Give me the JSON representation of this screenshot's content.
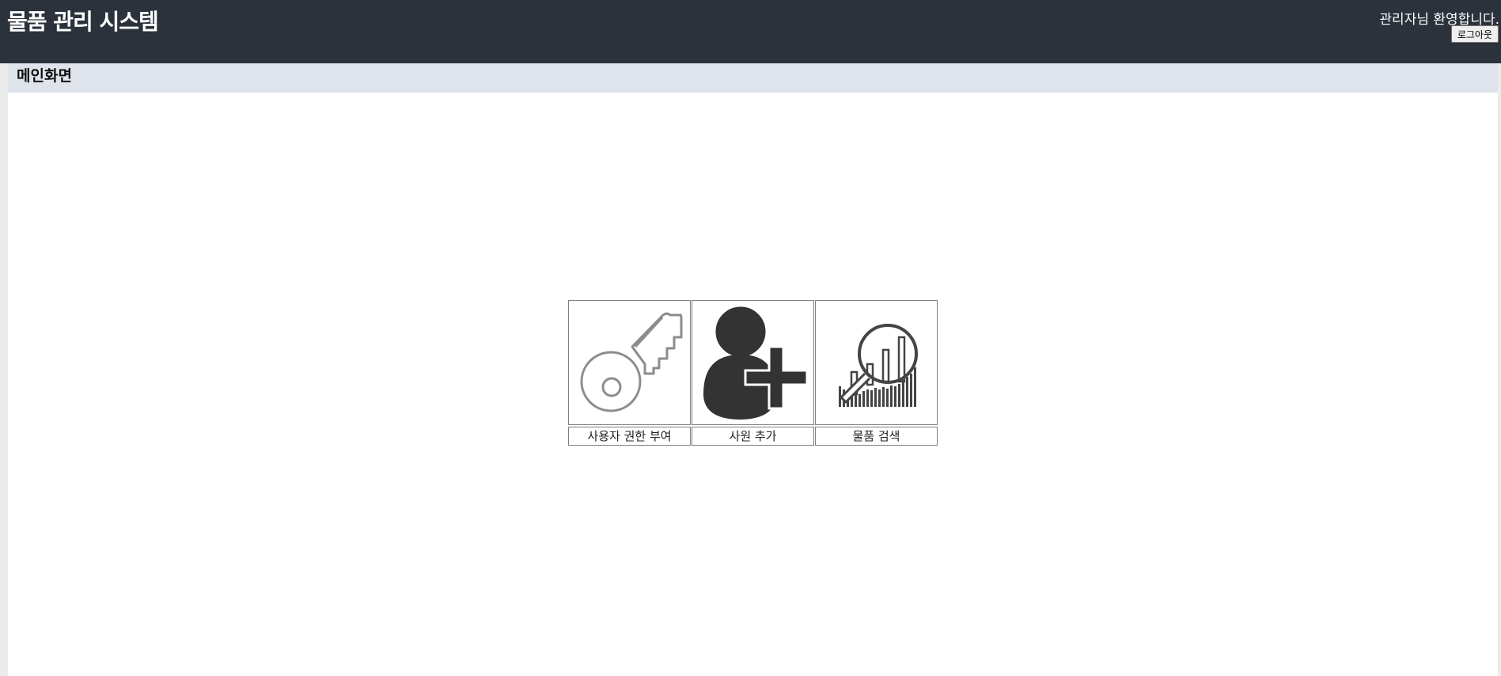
{
  "header": {
    "title": "물품 관리 시스템",
    "welcome_text": "관리자님 환영합니다.",
    "logout_label": "로그아웃",
    "background_color": "#2b323b"
  },
  "page": {
    "title": "메인화면"
  },
  "menu": {
    "items": [
      {
        "label": "사용자 권한 부여",
        "icon": "key-icon"
      },
      {
        "label": "사원 추가",
        "icon": "add-user-icon"
      },
      {
        "label": "물품 검색",
        "icon": "chart-search-icon"
      }
    ]
  }
}
